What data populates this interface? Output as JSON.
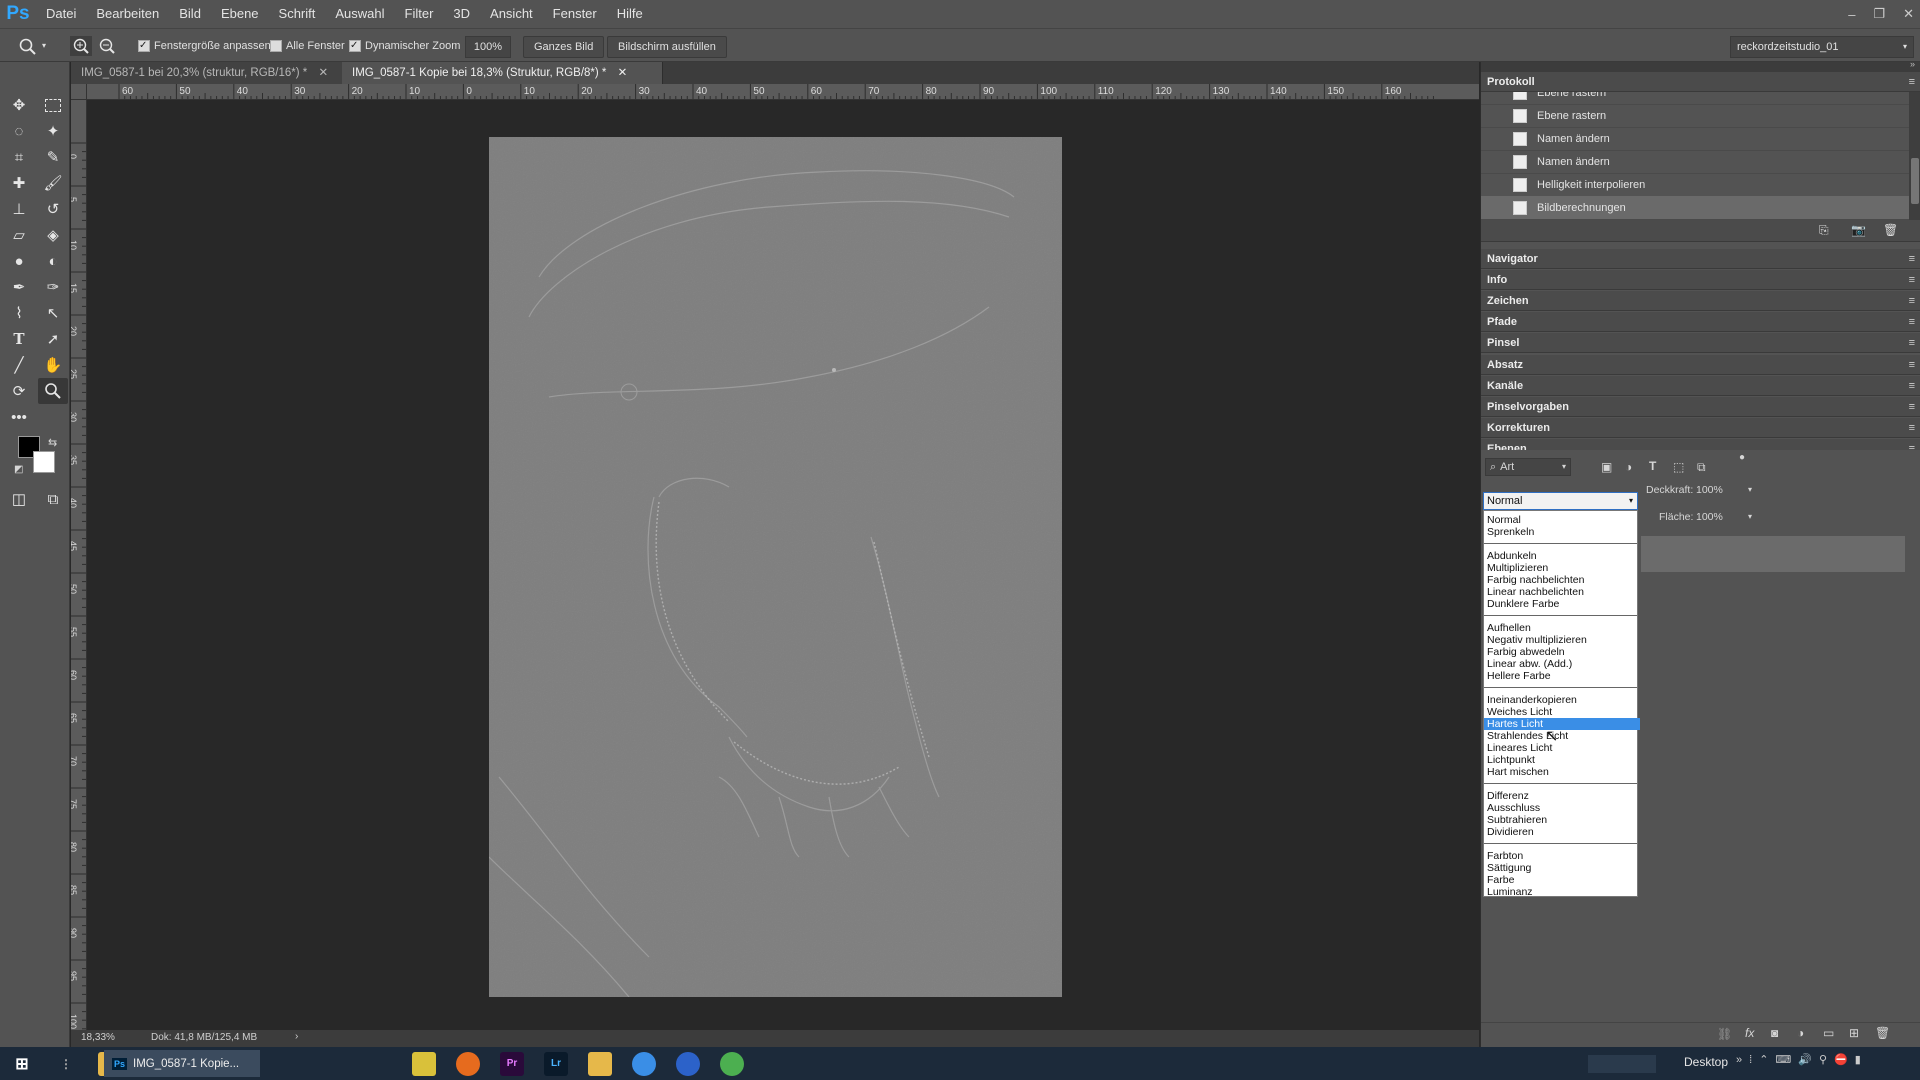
{
  "app": {
    "logo": "Ps"
  },
  "menu": [
    "Datei",
    "Bearbeiten",
    "Bild",
    "Ebene",
    "Schrift",
    "Auswahl",
    "Filter",
    "3D",
    "Ansicht",
    "Fenster",
    "Hilfe"
  ],
  "options": {
    "zoom_tool": "zoom-icon",
    "fit_window": "Fenstergröße anpassen",
    "all_windows": "Alle Fenster",
    "scrubby_zoom": "Dynamischer Zoom",
    "zoom_value": "100%",
    "fit_screen": "Ganzes Bild",
    "fill_screen": "Bildschirm ausfüllen",
    "workspace": "reckordzeitstudio_01"
  },
  "tabs": [
    "IMG_0587-1 bei 20,3% (struktur, RGB/16*) *",
    "IMG_0587-1 Kopie bei 18,3% (Struktur, RGB/8*) *"
  ],
  "ruler_top": [
    "60",
    "50",
    "40",
    "30",
    "20",
    "10",
    "0",
    "10",
    "20",
    "30",
    "40",
    "50",
    "60",
    "70",
    "80",
    "90",
    "100",
    "110",
    "120",
    "130",
    "140",
    "150",
    "160"
  ],
  "ruler_left": [
    "0",
    "5",
    "10",
    "15",
    "20",
    "25",
    "30",
    "35",
    "40",
    "45",
    "50",
    "55",
    "60",
    "65",
    "70",
    "75",
    "80",
    "85",
    "90",
    "95",
    "100"
  ],
  "status": {
    "zoom": "18,33%",
    "doc": "Dok: 41,8 MB/125,4 MB",
    "arrow": "›"
  },
  "history": {
    "title": "Protokoll",
    "items": [
      "Ebene rastern",
      "Ebene rastern",
      "Namen ändern",
      "Namen ändern",
      "Helligkeit interpolieren",
      "Bildberechnungen"
    ]
  },
  "panels": [
    "Navigator",
    "Info",
    "Zeichen",
    "Pfade",
    "Pinsel",
    "Absatz",
    "Kanäle",
    "Pinselvorgaben",
    "Korrekturen",
    "Ebenen"
  ],
  "layers": {
    "filter": "Art",
    "blend_mode": "Normal",
    "opacity_label": "Deckkraft:",
    "opacity": "100%",
    "fill_label": "Fläche:",
    "fill": "100%"
  },
  "blend_groups": [
    [
      "Normal",
      "Sprenkeln"
    ],
    [
      "Abdunkeln",
      "Multiplizieren",
      "Farbig nachbelichten",
      "Linear nachbelichten",
      "Dunklere Farbe"
    ],
    [
      "Aufhellen",
      "Negativ multiplizieren",
      "Farbig abwedeln",
      "Linear abw. (Add.)",
      "Hellere Farbe"
    ],
    [
      "Ineinanderkopieren",
      "Weiches Licht",
      "Hartes Licht",
      "Strahlendes Licht",
      "Lineares Licht",
      "Lichtpunkt",
      "Hart mischen"
    ],
    [
      "Differenz",
      "Ausschluss",
      "Subtrahieren",
      "Dividieren"
    ],
    [
      "Farbton",
      "Sättigung",
      "Farbe",
      "Luminanz"
    ]
  ],
  "blend_highlight": "Hartes Licht",
  "taskbar": {
    "active_app": "IMG_0587-1 Kopie...",
    "desktop": "Desktop"
  }
}
